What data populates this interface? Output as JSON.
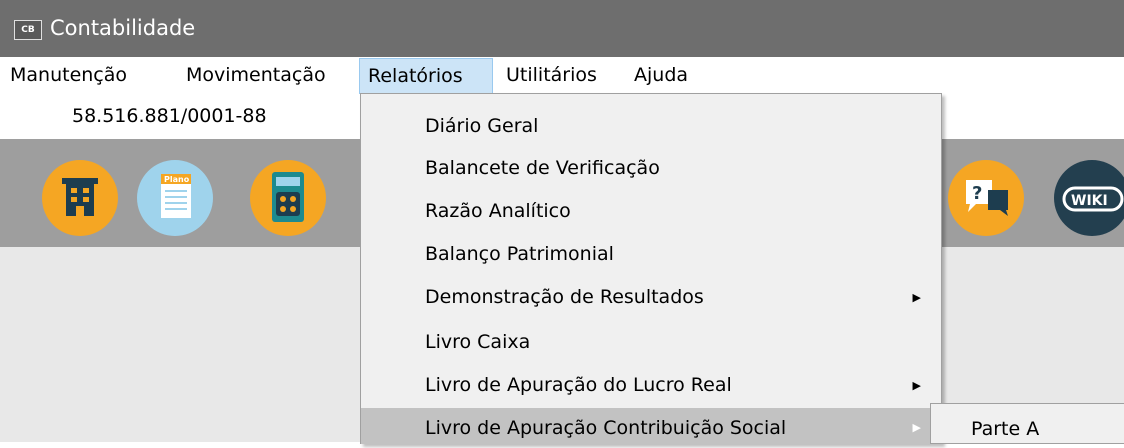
{
  "window": {
    "app_icon_label": "CB",
    "title": "Contabilidade"
  },
  "menubar": {
    "items": [
      "Manutenção",
      "Movimentação",
      "Relatórios",
      "Utilitários",
      "Ajuda"
    ],
    "active": "Relatórios"
  },
  "company": {
    "cnpj": "58.516.881/0001-88"
  },
  "toolbar": {
    "icons": [
      {
        "name": "company-building-icon",
        "color": "#f5a623"
      },
      {
        "name": "plano-document-icon",
        "color": "#9fd3ec",
        "label": "Plano"
      },
      {
        "name": "calculator-icon",
        "color": "#f5a623"
      },
      {
        "name": "help-chat-icon",
        "color": "#f5a623",
        "label": "?"
      },
      {
        "name": "wiki-icon",
        "color": "#233f4f",
        "label": "WIKI"
      }
    ]
  },
  "relatorios_menu": {
    "items": [
      {
        "label": "Diário Geral",
        "has_submenu": false
      },
      {
        "label": "Balancete de Verificação",
        "has_submenu": false
      },
      {
        "label": "Razão Analítico",
        "has_submenu": false
      },
      {
        "label": "Balanço Patrimonial",
        "has_submenu": false
      },
      {
        "label": "Demonstração de Resultados",
        "has_submenu": true
      },
      {
        "label": "Livro Caixa",
        "has_submenu": false
      },
      {
        "label": "Livro de Apuração do Lucro Real",
        "has_submenu": true
      },
      {
        "label": "Livro de Apuração Contribuição Social",
        "has_submenu": true,
        "highlighted": true
      }
    ]
  },
  "submenu": {
    "items": [
      "Parte A"
    ]
  }
}
